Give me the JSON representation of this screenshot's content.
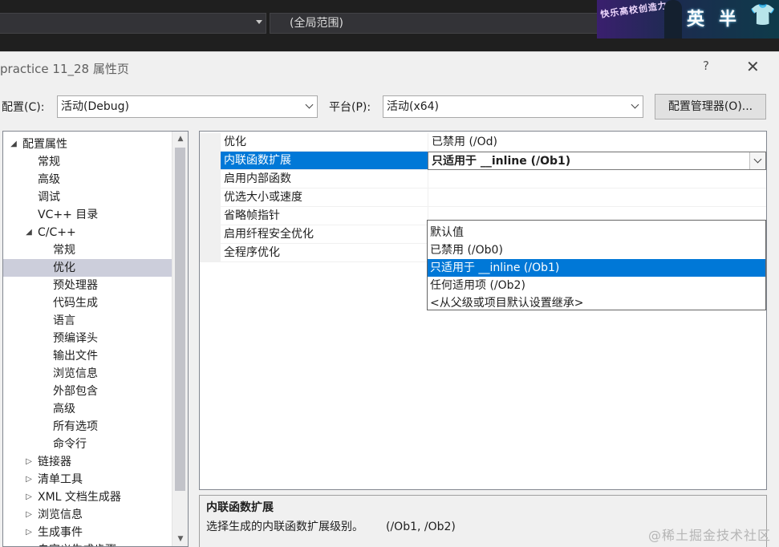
{
  "topbar": {
    "scope_value": "(全局范围)",
    "banner": {
      "badge": "快乐高校创造力",
      "word1": "英",
      "word2": "半",
      "shirt_icon": "shirt-icon"
    }
  },
  "dialog": {
    "title": "practice 11_28 属性页",
    "help": "?",
    "close": "✕",
    "config_label": "配置(C):",
    "config_value": "活动(Debug)",
    "platform_label": "平台(P):",
    "platform_value": "活动(x64)",
    "config_manager": "配置管理器(O)..."
  },
  "tree": {
    "items": [
      {
        "toggle": "◢",
        "label": "配置属性"
      },
      {
        "toggle": "",
        "label": "常规"
      },
      {
        "toggle": "",
        "label": "高级"
      },
      {
        "toggle": "",
        "label": "调试"
      },
      {
        "toggle": "",
        "label": "VC++ 目录"
      },
      {
        "toggle": "◢",
        "label": "C/C++"
      },
      {
        "toggle": "",
        "label": "常规"
      },
      {
        "toggle": "",
        "label": "优化"
      },
      {
        "toggle": "",
        "label": "预处理器"
      },
      {
        "toggle": "",
        "label": "代码生成"
      },
      {
        "toggle": "",
        "label": "语言"
      },
      {
        "toggle": "",
        "label": "预编译头"
      },
      {
        "toggle": "",
        "label": "输出文件"
      },
      {
        "toggle": "",
        "label": "浏览信息"
      },
      {
        "toggle": "",
        "label": "外部包含"
      },
      {
        "toggle": "",
        "label": "高级"
      },
      {
        "toggle": "",
        "label": "所有选项"
      },
      {
        "toggle": "",
        "label": "命令行"
      },
      {
        "toggle": "▷",
        "label": "链接器"
      },
      {
        "toggle": "▷",
        "label": "清单工具"
      },
      {
        "toggle": "▷",
        "label": "XML 文档生成器"
      },
      {
        "toggle": "▷",
        "label": "浏览信息"
      },
      {
        "toggle": "▷",
        "label": "生成事件"
      },
      {
        "toggle": "▷",
        "label": "自定义生成步骤"
      }
    ],
    "scroll_up": "▲",
    "scroll_down": "▼"
  },
  "properties": [
    {
      "name": "优化",
      "value": "已禁用 (/Od)"
    },
    {
      "name": "内联函数扩展",
      "value": "只适用于 __inline (/Ob1)"
    },
    {
      "name": "启用内部函数",
      "value": ""
    },
    {
      "name": "优选大小或速度",
      "value": ""
    },
    {
      "name": "省略帧指针",
      "value": ""
    },
    {
      "name": "启用纤程安全优化",
      "value": ""
    },
    {
      "name": "全程序优化",
      "value": ""
    }
  ],
  "dropdown_options": [
    "默认值",
    "已禁用 (/Ob0)",
    "只适用于 __inline (/Ob1)",
    "任何适用项 (/Ob2)",
    "<从父级或项目默认设置继承>"
  ],
  "description": {
    "title": "内联函数扩展",
    "text": "选择生成的内联函数扩展级别。",
    "flags": "(/Ob1, /Ob2)"
  },
  "watermark": "@稀土掘金技术社区"
}
